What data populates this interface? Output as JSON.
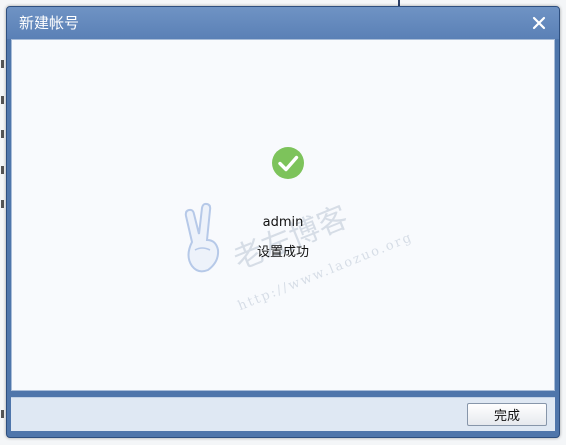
{
  "dialog": {
    "title": "新建帐号",
    "close_icon": "close-icon"
  },
  "result": {
    "icon": "check-circle-icon",
    "icon_color": "#7dc35b",
    "username": "admin",
    "message": "设置成功"
  },
  "watermark": {
    "text": "老左博客",
    "url": "http://www.laozuo.org",
    "icon": "victory-hand-icon"
  },
  "footer": {
    "done_label": "完成"
  }
}
